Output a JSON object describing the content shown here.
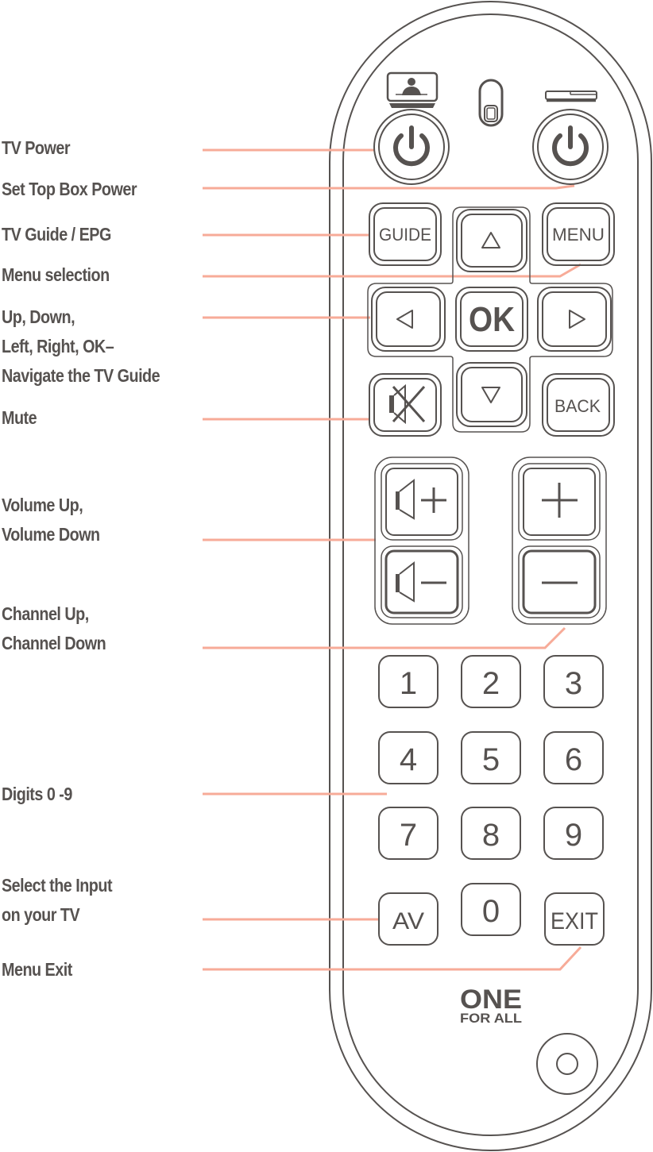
{
  "colors": {
    "outline": "#565250",
    "leader": "#f7ab98",
    "text": "#565250",
    "background": "#ffffff"
  },
  "labels": [
    {
      "id": "tv-power",
      "lines": [
        "TV Power"
      ]
    },
    {
      "id": "stb-power",
      "lines": [
        "Set Top Box Power"
      ]
    },
    {
      "id": "guide",
      "lines": [
        "TV Guide / EPG"
      ]
    },
    {
      "id": "menu",
      "lines": [
        "Menu selection"
      ]
    },
    {
      "id": "nav",
      "lines": [
        "Up, Down,",
        "Left, Right, OK–",
        "Navigate the TV Guide"
      ]
    },
    {
      "id": "mute",
      "lines": [
        "Mute"
      ]
    },
    {
      "id": "volume",
      "lines": [
        "Volume Up,",
        "Volume Down"
      ]
    },
    {
      "id": "channel",
      "lines": [
        "Channel Up,",
        "Channel Down"
      ]
    },
    {
      "id": "digits",
      "lines": [
        "Digits 0 -9"
      ]
    },
    {
      "id": "input",
      "lines": [
        "Select the Input",
        "on your TV"
      ]
    },
    {
      "id": "exit",
      "lines": [
        "Menu Exit"
      ]
    }
  ],
  "remote": {
    "device_icons": {
      "left": "tv-icon",
      "center": "slide-switch-icon",
      "right": "set-top-box-icon"
    },
    "power_buttons": [
      {
        "id": "tv-power",
        "icon": "power-icon"
      },
      {
        "id": "stb-power",
        "icon": "power-icon"
      }
    ],
    "buttons": {
      "guide": "GUIDE",
      "menu": "MENU",
      "ok": "OK",
      "back": "BACK",
      "av": "AV",
      "exit": "EXIT"
    },
    "nav_icons": {
      "up": "triangle-up-icon",
      "down": "triangle-down-icon",
      "left": "triangle-left-icon",
      "right": "triangle-right-icon"
    },
    "mute_icon": "mute-icon",
    "volume": {
      "up": "volume-up-icon",
      "down": "volume-down-icon"
    },
    "channel": {
      "up": "plus-icon",
      "down": "minus-icon"
    },
    "digits": [
      "1",
      "2",
      "3",
      "4",
      "5",
      "6",
      "7",
      "8",
      "9",
      "0"
    ],
    "brand": {
      "line1": "ONE",
      "line2": "FOR ALL"
    },
    "bottom_icon": "round-button-icon"
  }
}
